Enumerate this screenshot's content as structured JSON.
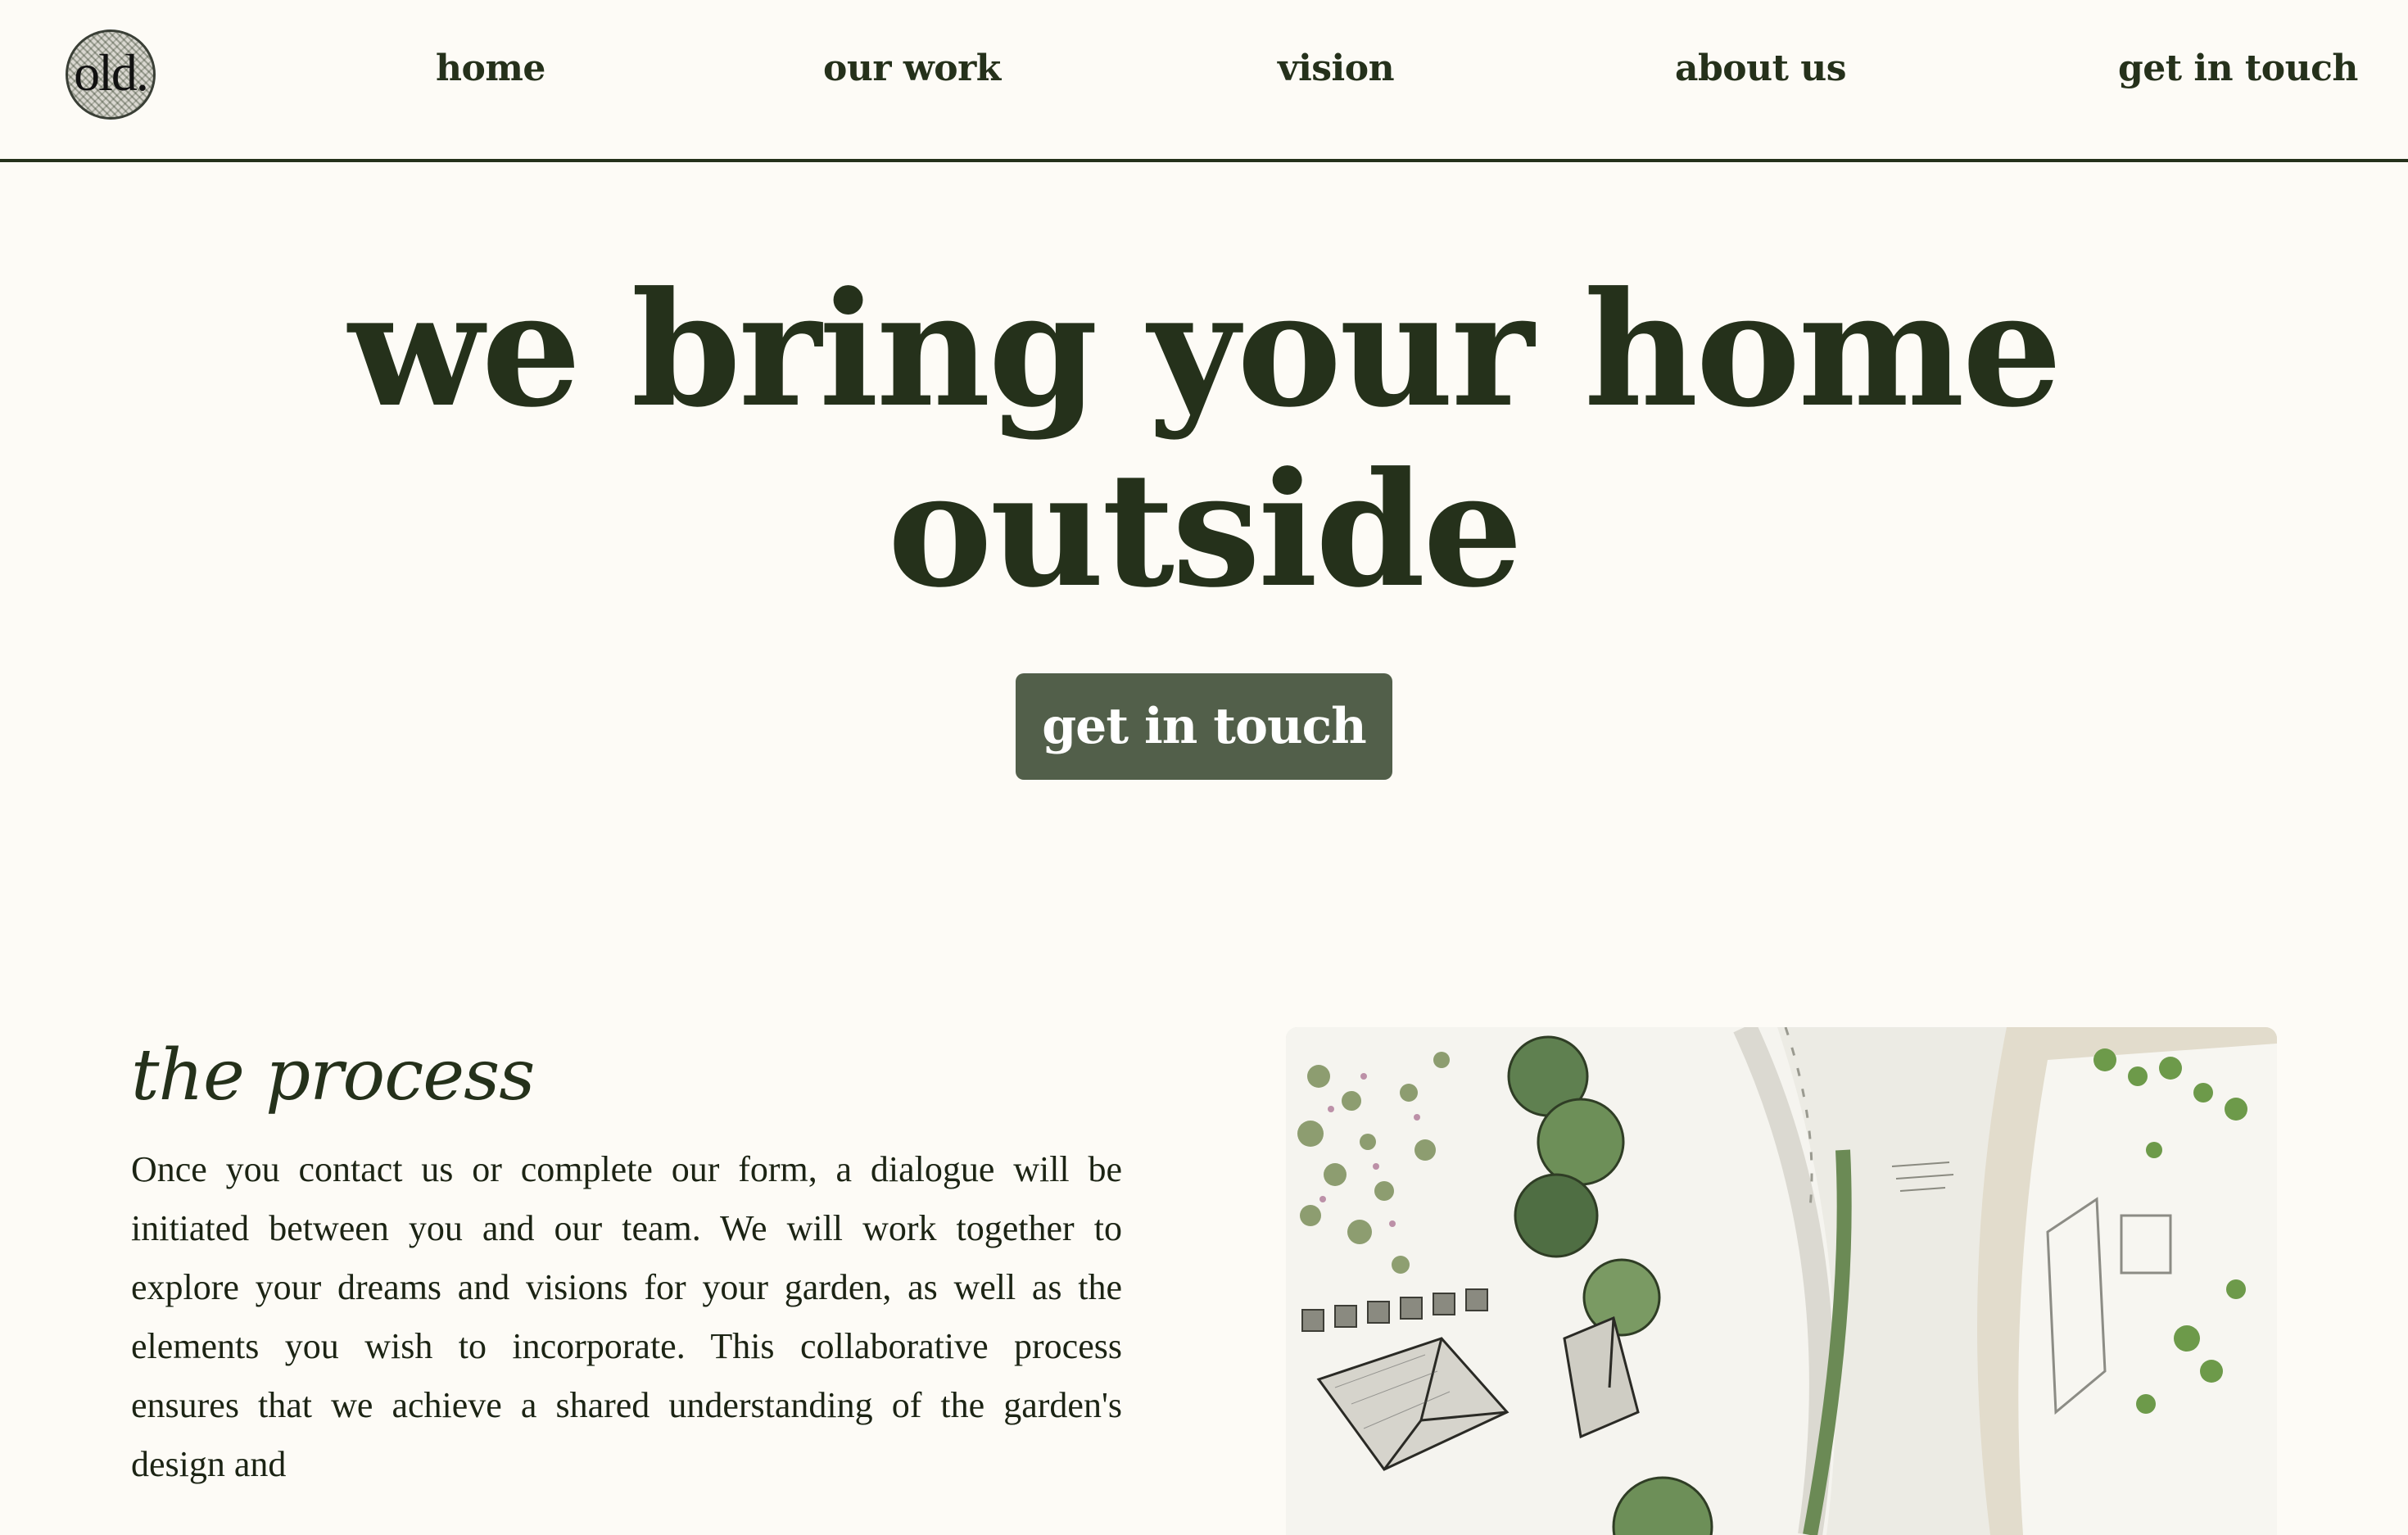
{
  "brand": {
    "logo_text": "old."
  },
  "nav": {
    "items": [
      {
        "label": "home"
      },
      {
        "label": "our work"
      },
      {
        "label": "vision"
      },
      {
        "label": "about us"
      },
      {
        "label": "get in touch"
      }
    ]
  },
  "hero": {
    "title_line1": "we bring your home",
    "title_line2": "outside",
    "cta_label": "get in touch"
  },
  "process": {
    "title": "the process",
    "body": "Once you contact us or complete our form, a dialogue will be initiated between you and our team. We will work together to explore your dreams and visions for your garden, as well as the elements you wish to incorporate. This collaborative process ensures that we achieve a shared understanding of the garden's design and"
  },
  "colors": {
    "background": "#fdfbf6",
    "text_dark_green": "#25311b",
    "button_green": "#525f4a",
    "button_text": "#ffffff"
  }
}
